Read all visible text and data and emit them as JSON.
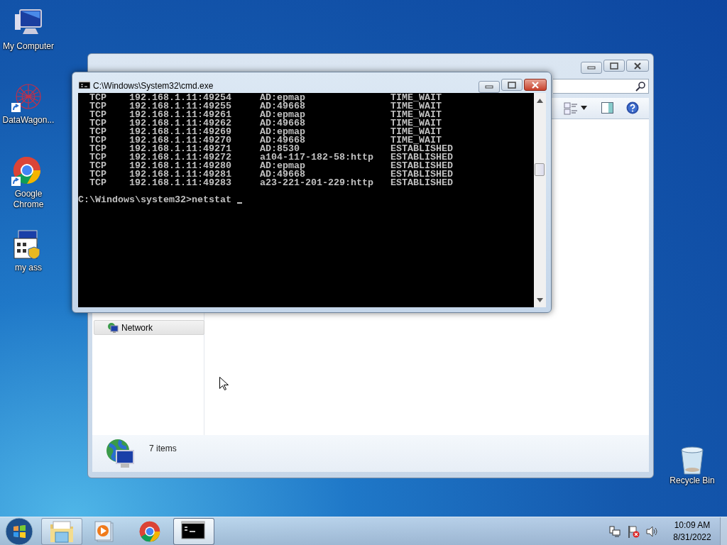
{
  "desktop_icons": [
    {
      "kind": "computer",
      "label": "My Computer",
      "shortcut": false
    },
    {
      "kind": "network-art",
      "label": "DataWagon...",
      "shortcut": true
    },
    {
      "kind": "chrome",
      "label": "Google Chrome",
      "shortcut": true
    },
    {
      "kind": "program",
      "label": "my ass",
      "shortcut": false
    }
  ],
  "recycle_bin": {
    "label": "Recycle Bin"
  },
  "explorer": {
    "nav_items": [
      {
        "label": "Network",
        "selected": true
      }
    ],
    "status": "7 items"
  },
  "cmd": {
    "title": "C:\\Windows\\System32\\cmd.exe",
    "lines": [
      "  TCP    192.168.1.11:49254     AD:epmap               TIME_WAIT",
      "  TCP    192.168.1.11:49255     AD:49668               TIME_WAIT",
      "  TCP    192.168.1.11:49261     AD:epmap               TIME_WAIT",
      "  TCP    192.168.1.11:49262     AD:49668               TIME_WAIT",
      "  TCP    192.168.1.11:49269     AD:epmap               TIME_WAIT",
      "  TCP    192.168.1.11:49270     AD:49668               TIME_WAIT",
      "  TCP    192.168.1.11:49271     AD:8530                ESTABLISHED",
      "  TCP    192.168.1.11:49272     a104-117-182-58:http   ESTABLISHED",
      "  TCP    192.168.1.11:49280     AD:epmap               ESTABLISHED",
      "  TCP    192.168.1.11:49281     AD:49668               ESTABLISHED",
      "  TCP    192.168.1.11:49283     a23-221-201-229:http   ESTABLISHED"
    ],
    "prompt": "C:\\Windows\\system32>netstat"
  },
  "taskbar": {
    "items": [
      {
        "kind": "explorer",
        "running": true,
        "selected": false
      },
      {
        "kind": "media",
        "running": false,
        "selected": false
      },
      {
        "kind": "chrome",
        "running": false,
        "selected": false
      },
      {
        "kind": "cmd",
        "running": true,
        "selected": true
      }
    ]
  },
  "clock": {
    "time": "10:09 AM",
    "date": "8/31/2022"
  }
}
